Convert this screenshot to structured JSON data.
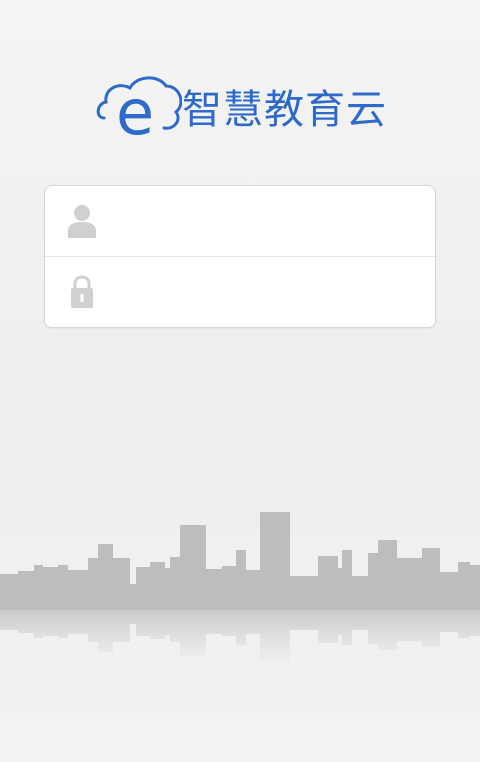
{
  "brand": {
    "name": "智慧教育云",
    "mark_letter": "e",
    "color": "#2e6ac9"
  },
  "login": {
    "username": {
      "icon": "user-icon",
      "value": "",
      "placeholder": ""
    },
    "password": {
      "icon": "lock-icon",
      "value": "",
      "placeholder": ""
    }
  },
  "colors": {
    "background": "#efefef",
    "panel": "#ffffff",
    "icon": "#d0d0d0",
    "skyline": "#bdbdbd"
  }
}
